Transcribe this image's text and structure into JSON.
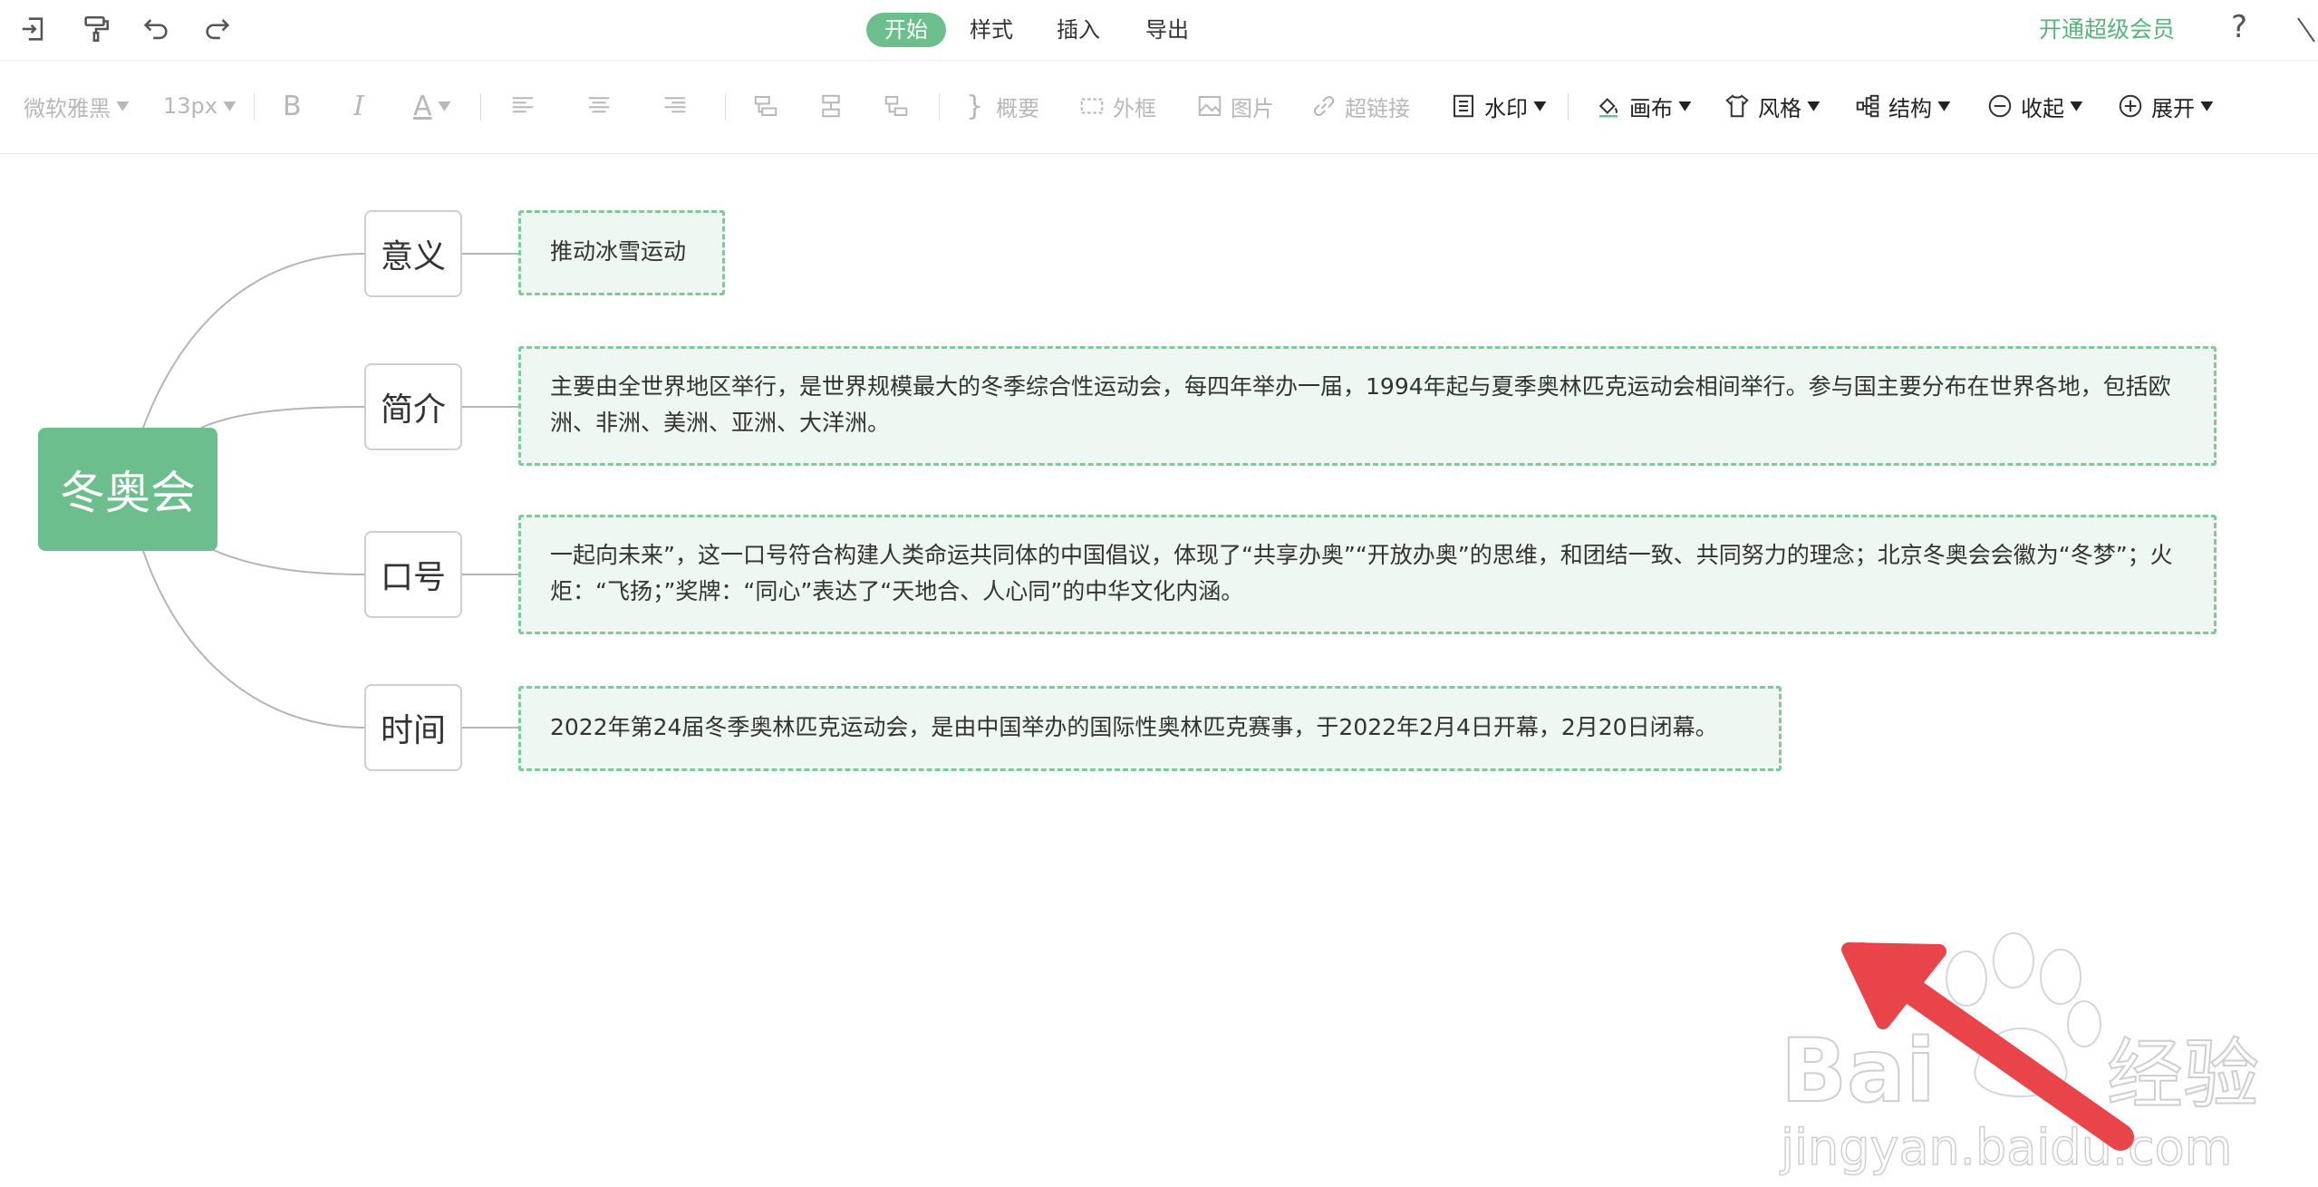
{
  "menu": {
    "tabs": [
      "开始",
      "样式",
      "插入",
      "导出"
    ],
    "vip_label": "开通超级会员",
    "help_label": "?"
  },
  "toolbar": {
    "font_family": "微软雅黑",
    "font_size": "13px",
    "bold": "B",
    "italic": "I",
    "font_color": "A",
    "summary": "概要",
    "frame": "外框",
    "image": "图片",
    "hyperlink": "超链接",
    "watermark": "水印",
    "canvas": "画布",
    "style": "风格",
    "structure": "结构",
    "collapse": "收起",
    "expand": "展开"
  },
  "mindmap": {
    "root": "冬奥会",
    "branches": [
      {
        "title": "意义",
        "detail": "推动冰雪运动"
      },
      {
        "title": "简介",
        "detail": "主要由全世界地区举行，是世界规模最大的冬季综合性运动会，每四年举办一届，1994年起与夏季奥林匹克运动会相间举行。参与国主要分布在世界各地，包括欧洲、非洲、美洲、亚洲、大洋洲。"
      },
      {
        "title": "口号",
        "detail": "一起向未来”，这一口号符合构建人类命运共同体的中国倡议，体现了“共享办奥”“开放办奥”的思维，和团结一致、共同努力的理念；北京冬奥会会徽为“冬梦”；火炬：“飞扬；”奖牌：“同心”表达了“天地合、人心同”的中华文化内涵。"
      },
      {
        "title": "时间",
        "detail": "2022年第24届冬季奥林匹克运动会，是由中国举办的国际性奥林匹克赛事，于2022年2月4日开幕，2月20日闭幕。"
      }
    ]
  },
  "watermark": {
    "brand": "Bai",
    "brand_suffix": "经验",
    "url": "jingyan.baidu.com"
  },
  "colors": {
    "accent": "#6cbe8c",
    "vip": "#5bb27c",
    "leaf_border": "#7fca9a",
    "leaf_bg": "#eef7f1",
    "arrow": "#e8444a"
  }
}
